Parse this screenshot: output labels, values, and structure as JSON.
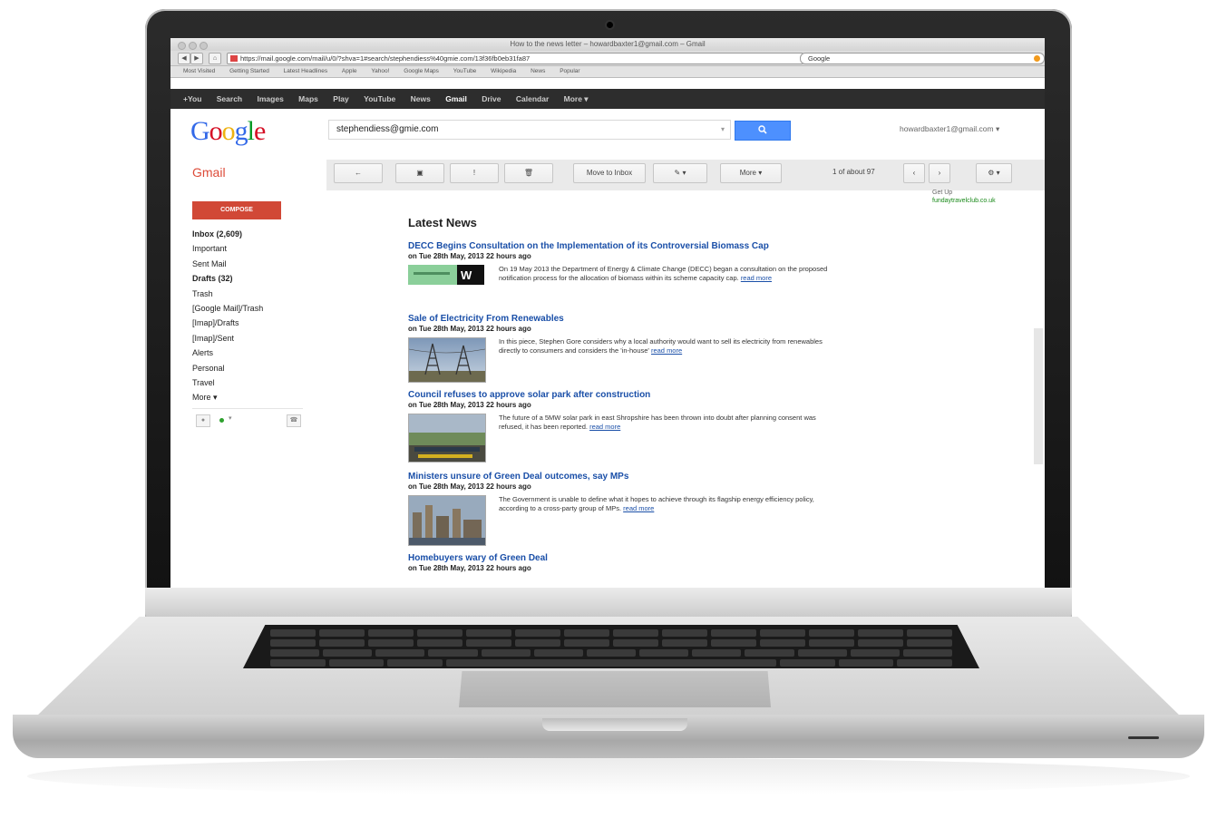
{
  "browser": {
    "window_title": "How to the news letter – howardbaxter1@gmail.com – Gmail",
    "url": "https://mail.google.com/mail/u/0/?shva=1#search/stephendiess%40gmie.com/13f36fb0eb31fa87",
    "search_value": "Google",
    "bookmarks": [
      "Most Visited",
      "Getting Started",
      "Latest Headlines",
      "Apple",
      "Yahoo!",
      "Google Maps",
      "YouTube",
      "Wikipedia",
      "News",
      "Popular"
    ]
  },
  "google_bar": {
    "items": [
      "+You",
      "Search",
      "Images",
      "Maps",
      "Play",
      "YouTube",
      "News",
      "Gmail",
      "Drive",
      "Calendar",
      "More ▾"
    ],
    "active": "Gmail"
  },
  "header": {
    "logo": "Google",
    "logo_colors": [
      "#3369e8",
      "#d50f25",
      "#eeb211",
      "#3369e8",
      "#009925",
      "#d50f25"
    ],
    "search_value": "stephendiess@gmie.com",
    "search_button_icon": "magnifier-icon",
    "account": "howardbaxter1@gmail.com ▾"
  },
  "toolbar": {
    "app_label": "Gmail",
    "back": "←",
    "archive": "▣",
    "spam": "!",
    "delete": "🗑",
    "move_to_inbox": "Move to Inbox",
    "labels": "✎ ▾",
    "more": "More ▾",
    "pager": "1 of about 97",
    "prev": "‹",
    "next": "›",
    "settings": "⚙ ▾"
  },
  "sidebar": {
    "compose": "COMPOSE",
    "items": [
      {
        "label": "Inbox (2,609)",
        "bold": true
      },
      {
        "label": "Important",
        "bold": false
      },
      {
        "label": "Sent Mail",
        "bold": false
      },
      {
        "label": "Drafts (32)",
        "bold": true
      },
      {
        "label": "Trash",
        "bold": false
      },
      {
        "label": "[Google Mail]/Trash",
        "bold": false
      },
      {
        "label": "[Imap]/Drafts",
        "bold": false
      },
      {
        "label": "[Imap]/Sent",
        "bold": false
      },
      {
        "label": "Alerts",
        "bold": false
      },
      {
        "label": "Personal",
        "bold": false
      },
      {
        "label": "Travel",
        "bold": false
      },
      {
        "label": "More ▾",
        "bold": false
      }
    ]
  },
  "ad": {
    "line1": "Get Up",
    "line2": "fundaytravelclub.co.uk"
  },
  "content": {
    "heading": "Latest News",
    "articles": [
      {
        "title": "DECC Begins Consultation on the Implementation of its Controversial Biomass Cap",
        "date": "on Tue 28th May, 2013 22 hours ago",
        "text": "On 19 May 2013 the Department of Energy & Climate Change (DECC) began a consultation on the proposed notification process for the allocation of biomass within its scheme capacity cap.",
        "link": "read more",
        "thumb": "logo"
      },
      {
        "title": "Sale of Electricity From Renewables",
        "date": "on Tue 28th May, 2013 22 hours ago",
        "text": "In this piece, Stephen Gore considers why a local authority would want to sell its electricity from renewables directly to consumers and considers the 'in-house'",
        "link": "read more",
        "thumb": "pylons"
      },
      {
        "title": "Council refuses to approve solar park after construction",
        "date": "on Tue 28th May, 2013 22 hours ago",
        "text": "The future of a 5MW solar park in east Shropshire has been thrown into doubt after planning consent was refused, it has been reported.",
        "link": "read more",
        "thumb": "solar"
      },
      {
        "title": "Ministers unsure of Green Deal outcomes, say MPs",
        "date": "on Tue 28th May, 2013 22 hours ago",
        "text": "The Government is unable to define what it hopes to achieve through its flagship energy efficiency policy, according to a cross-party group of MPs.",
        "link": "read more",
        "thumb": "city"
      },
      {
        "title": "Homebuyers wary of Green Deal",
        "date": "on Tue 28th May, 2013 22 hours ago",
        "text": "",
        "link": "",
        "thumb": "none"
      }
    ]
  }
}
